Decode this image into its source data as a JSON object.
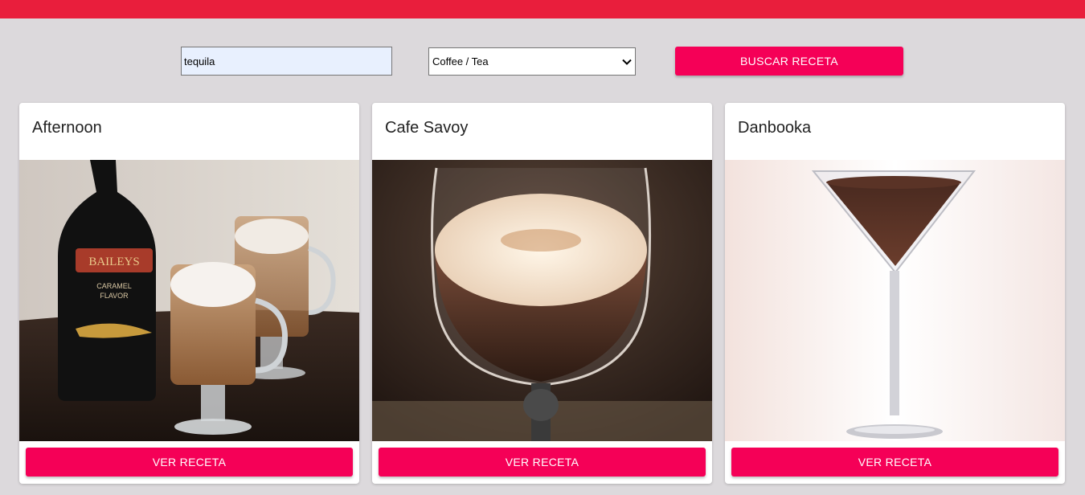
{
  "header": {
    "color": "#e91e3c"
  },
  "search": {
    "value": "tequila",
    "placeholder": ""
  },
  "category": {
    "selected": "Coffee / Tea"
  },
  "search_button": {
    "label": "BUSCAR RECETA"
  },
  "cards": [
    {
      "title": "Afternoon",
      "button_label": "VER RECETA",
      "image": "coffee-liqueur-drinks-photo"
    },
    {
      "title": "Cafe Savoy",
      "button_label": "VER RECETA",
      "image": "foamed-coffee-glass-photo"
    },
    {
      "title": "Danbooka",
      "button_label": "VER RECETA",
      "image": "chocolate-martini-photo"
    }
  ],
  "colors": {
    "accent": "#f50057",
    "background": "#dcd9dc"
  }
}
